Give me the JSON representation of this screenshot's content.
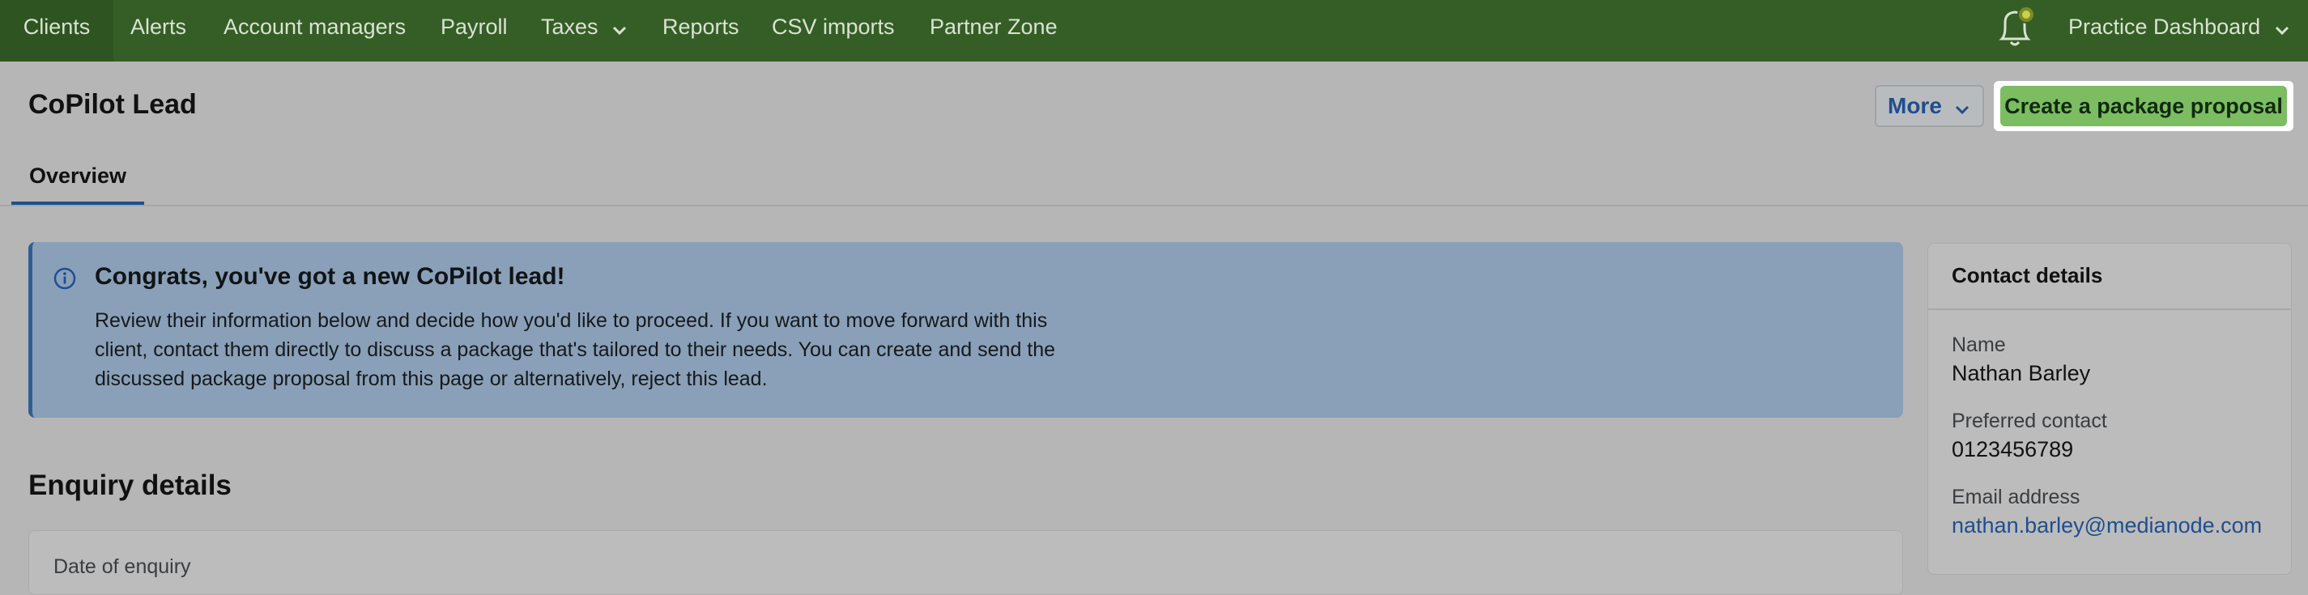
{
  "nav": {
    "items": [
      "Clients",
      "Alerts",
      "Account managers",
      "Payroll",
      "Taxes",
      "Reports",
      "CSV imports",
      "Partner Zone"
    ],
    "active": "Clients",
    "right_label": "Practice Dashboard",
    "icons": [
      "chevron-down-icon",
      "bell-icon"
    ]
  },
  "header": {
    "title": "CoPilot Lead",
    "more_label": "More",
    "create_label": "Create a package proposal"
  },
  "tabs": [
    "Overview"
  ],
  "banner": {
    "icon": "info-icon",
    "title": "Congrats, you've got a new CoPilot lead!",
    "lines": [
      "Review their information below and decide how you'd like to proceed. If you want to move forward with this",
      "client, contact them directly to discuss a package that's tailored to their needs. You can create and send the",
      "discussed package proposal from this page or alternatively, reject this lead."
    ]
  },
  "enquiry": {
    "title": "Enquiry details",
    "date_label": "Date of enquiry"
  },
  "contact": {
    "title": "Contact details",
    "name_label": "Name",
    "name_value": "Nathan Barley",
    "preferred_label": "Preferred contact",
    "preferred_value": "0123456789",
    "email_label": "Email address",
    "email_value": "nathan.barley@medianode.com"
  },
  "colors": {
    "nav_bg": "#355e26",
    "primary_button": "#7cbd62",
    "link": "#1f4e8f",
    "banner_bg": "#8aa0b8"
  }
}
